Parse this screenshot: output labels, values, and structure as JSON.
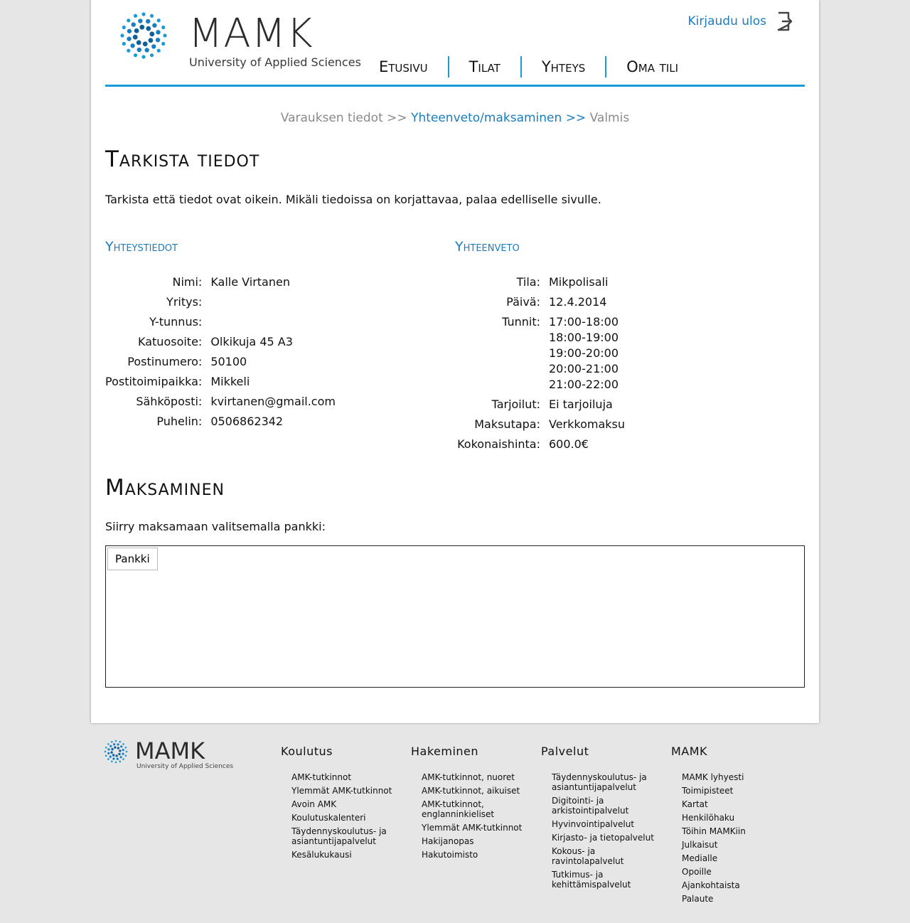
{
  "header": {
    "logo_text": "MAMK",
    "logo_subtitle": "University of Applied Sciences",
    "logout_label": "Kirjaudu ulos",
    "nav": [
      "Etusivu",
      "Tilat",
      "Yhteys",
      "Oma tili"
    ]
  },
  "steps": {
    "step1": "Varauksen tiedot",
    "sep1": ">>",
    "step2": "Yhteenveto/maksaminen",
    "sep2": ">>",
    "step3": "Valmis"
  },
  "check": {
    "title": "Tarkista tiedot",
    "intro": "Tarkista että tiedot ovat oikein. Mikäli tiedoissa on korjattavaa, palaa edelliselle sivulle."
  },
  "contact": {
    "heading": "Yhteystiedot",
    "rows": [
      {
        "label": "Nimi:",
        "value": "Kalle Virtanen"
      },
      {
        "label": "Yritys:",
        "value": ""
      },
      {
        "label": "Y-tunnus:",
        "value": ""
      },
      {
        "label": "Katuosoite:",
        "value": "Olkikuja 45 A3"
      },
      {
        "label": "Postinumero:",
        "value": "50100"
      },
      {
        "label": "Postitoimipaikka:",
        "value": "Mikkeli"
      },
      {
        "label": "Sähköposti:",
        "value": "kvirtanen@gmail.com"
      },
      {
        "label": "Puhelin:",
        "value": "0506862342"
      }
    ]
  },
  "summary": {
    "heading": "Yhteenveto",
    "tila_label": "Tila:",
    "tila": "Mikpolisali",
    "paiva_label": "Päivä:",
    "paiva": "12.4.2014",
    "tunnit_label": "Tunnit:",
    "tunnit": [
      "17:00-18:00",
      "18:00-19:00",
      "19:00-20:00",
      "20:00-21:00",
      "21:00-22:00"
    ],
    "tarjoilut_label": "Tarjoilut:",
    "tarjoilut": "Ei tarjoiluja",
    "maksutapa_label": "Maksutapa:",
    "maksutapa": "Verkkomaksu",
    "hinta_label": "Kokonaishinta:",
    "hinta": "600.0€"
  },
  "payment": {
    "title": "Maksaminen",
    "intro": "Siirry maksamaan valitsemalla pankki:",
    "bank_button": "Pankki"
  },
  "footer": {
    "logo_text": "MAMK",
    "logo_subtitle": "University of Applied Sciences",
    "columns": [
      {
        "title": "Koulutus",
        "links": [
          "AMK-tutkinnot",
          "Ylemmät AMK-tutkinnot",
          "Avoin AMK",
          "Koulutuskalenteri",
          "Täydennyskoulutus- ja asiantuntijapalvelut",
          "Kesälukukausi"
        ]
      },
      {
        "title": "Hakeminen",
        "links": [
          "AMK-tutkinnot, nuoret",
          "AMK-tutkinnot, aikuiset",
          "AMK-tutkinnot, englanninkieliset",
          "Ylemmät AMK-tutkinnot",
          "Hakijanopas",
          "Hakutoimisto"
        ]
      },
      {
        "title": "Palvelut",
        "links": [
          "Täydennyskoulutus- ja asiantuntijapalvelut",
          "Digitointi- ja arkistointipalvelut",
          "Hyvinvointipalvelut",
          "Kirjasto- ja tietopalvelut",
          "Kokous- ja ravintolapalvelut",
          "Tutkimus- ja kehittämispalvelut"
        ]
      },
      {
        "title": "MAMK",
        "links": [
          "MAMK lyhyesti",
          "Toimipisteet",
          "Kartat",
          "Henkilöhaku",
          "Töihin MAMKiin",
          "Julkaisut",
          "Medialle",
          "Opoille",
          "Ajankohtaista",
          "Palaute"
        ]
      }
    ]
  },
  "colors": {
    "accent": "#1a9ad6",
    "link": "#1a7dc0",
    "background": "#e6e6e6"
  }
}
